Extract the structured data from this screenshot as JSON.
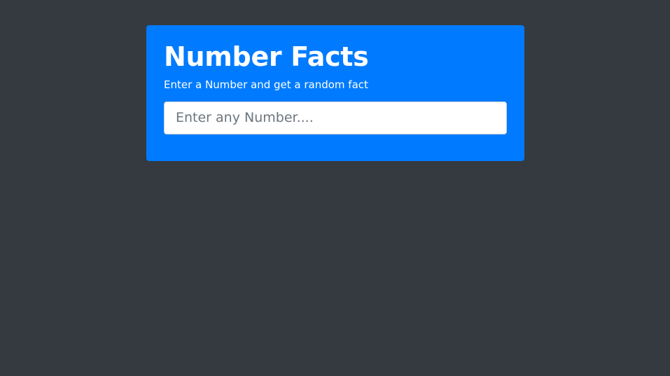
{
  "header": {
    "title": "Number Facts",
    "subtitle": "Enter a Number and get a random fact"
  },
  "number_input": {
    "value": "",
    "placeholder": "Enter any Number...."
  },
  "colors": {
    "background": "#343a40",
    "card": "#007bff",
    "text": "#ffffff"
  }
}
